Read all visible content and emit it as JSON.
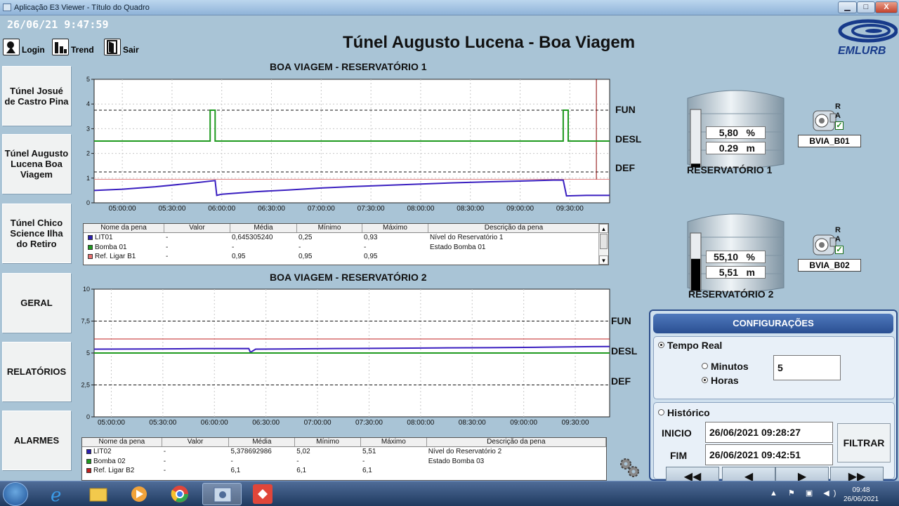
{
  "window": {
    "title": "Aplicação E3 Viewer - Título do Quadro",
    "min": "▁",
    "max": "□",
    "close": "X"
  },
  "header": {
    "clock": "26/06/21 9:47:59",
    "title": "Túnel Augusto Lucena - Boa Viagem",
    "logo_text": "EMLURB",
    "buttons": {
      "login": "Login",
      "trend": "Trend",
      "exit": "Sair"
    }
  },
  "nav": [
    {
      "label": "Túnel Josué de Castro Pina"
    },
    {
      "label": "Túnel Augusto Lucena Boa Viagem"
    },
    {
      "label": "Túnel Chico Science Ilha do Retiro"
    },
    {
      "label": "GERAL"
    },
    {
      "label": "RELATÓRIOS"
    },
    {
      "label": "ALARMES"
    }
  ],
  "legend_headers": [
    "Nome da pena",
    "Valor",
    "Média",
    "Mínimo",
    "Máximo",
    "Descrição da pena"
  ],
  "legend1": [
    {
      "name": "LIT01",
      "valor": "-",
      "media": "0,645305240",
      "min": "0,25",
      "max": "0,93",
      "desc": "Nível do Reservatório 1",
      "color": "#2b1fb0"
    },
    {
      "name": "Bomba 01",
      "valor": "-",
      "media": "-",
      "min": "-",
      "max": "-",
      "desc": "Estado Bomba 01",
      "color": "#1f9a1f"
    },
    {
      "name": "Ref. Ligar B1",
      "valor": "-",
      "media": "0,95",
      "min": "0,95",
      "max": "0,95",
      "desc": "",
      "color": "#e87070"
    }
  ],
  "legend2": [
    {
      "name": "LIT02",
      "valor": "-",
      "media": "5,378692986",
      "min": "5,02",
      "max": "5,51",
      "desc": "Nível do Reservatório 2",
      "color": "#2b1fb0"
    },
    {
      "name": "Bomba 02",
      "valor": "-",
      "media": "-",
      "min": "-",
      "max": "-",
      "desc": "Estado Bomba 03",
      "color": "#1f9a1f"
    },
    {
      "name": "Ref. Ligar B2",
      "valor": "-",
      "media": "6,1",
      "min": "6,1",
      "max": "6,1",
      "desc": "",
      "color": "#c02020"
    }
  ],
  "side_labels1": {
    "fun": "FUN",
    "desl": "DESL",
    "def": "DEF"
  },
  "side_labels2": {
    "fun": "FUN",
    "desl": "DESL",
    "def": "DEF"
  },
  "tanks": [
    {
      "percent": "5,80",
      "percent_unit": "%",
      "meters": "0.29",
      "meters_unit": "m",
      "name": "RESERVATÓRIO 1",
      "fill": 0.058
    },
    {
      "percent": "55,10",
      "percent_unit": "%",
      "meters": "5,51",
      "meters_unit": "m",
      "name": "RESERVATÓRIO 2",
      "fill": 0.551
    }
  ],
  "pumps": [
    {
      "name": "BVIA_B01",
      "r": "R",
      "a": "A"
    },
    {
      "name": "BVIA_B02",
      "r": "R",
      "a": "A"
    }
  ],
  "config": {
    "header": "CONFIGURAÇÕES",
    "realtime": "Tempo Real",
    "minutos": "Minutos",
    "horas": "Horas",
    "period_value": "5",
    "historico": "Histórico",
    "inicio_label": "INICIO",
    "inicio_value": "26/06/2021 09:28:27",
    "fim_label": "FIM",
    "fim_value": "26/06/2021 09:42:51",
    "filtrar": "FILTRAR",
    "nav_buttons": [
      "◀◀",
      "◀",
      "▶",
      "▶▶"
    ]
  },
  "taskbar": {
    "time": "09:48",
    "date": "26/06/2021"
  },
  "chart_data": [
    {
      "type": "line",
      "title": "BOA VIAGEM - RESERVATÓRIO 1",
      "xlabel": "",
      "ylabel": "",
      "x_ticks": [
        "05:00:00",
        "05:30:00",
        "06:00:00",
        "06:30:00",
        "07:00:00",
        "07:30:00",
        "08:00:00",
        "08:30:00",
        "09:00:00",
        "09:30:00"
      ],
      "x_tick_values": [
        300,
        330,
        360,
        390,
        420,
        450,
        480,
        510,
        540,
        570
      ],
      "xlim": [
        283,
        594
      ],
      "y_ticks": [
        "0",
        "1",
        "2",
        "3",
        "4",
        "5"
      ],
      "y_tick_values": [
        0,
        1,
        2,
        3,
        4,
        5
      ],
      "ylim": [
        0,
        5
      ],
      "grid": true,
      "hlines": [
        {
          "y": 3.75,
          "style": "dashed",
          "color": "#111"
        },
        {
          "y": 1.25,
          "style": "dashed",
          "color": "#111"
        },
        {
          "y": 0.95,
          "style": "solid",
          "color": "#e08080"
        }
      ],
      "vline": {
        "x": 586,
        "color": "#8b0000"
      },
      "series": [
        {
          "name": "LIT01",
          "color": "#3a1fc0",
          "x": [
            283,
            300,
            320,
            340,
            356,
            357,
            360,
            380,
            400,
            420,
            440,
            460,
            480,
            500,
            520,
            540,
            560,
            566,
            568,
            580,
            594
          ],
          "y": [
            0.5,
            0.55,
            0.65,
            0.78,
            0.9,
            0.3,
            0.35,
            0.45,
            0.52,
            0.6,
            0.66,
            0.71,
            0.76,
            0.81,
            0.85,
            0.88,
            0.92,
            0.92,
            0.28,
            0.3,
            0.3
          ]
        },
        {
          "name": "Bomba 01",
          "color": "#1f9a1f",
          "x": [
            283,
            353,
            353,
            356,
            356,
            566,
            566,
            569,
            569,
            594
          ],
          "y": [
            2.5,
            2.5,
            3.75,
            3.75,
            2.5,
            2.5,
            3.75,
            3.75,
            2.5,
            2.5
          ]
        }
      ]
    },
    {
      "type": "line",
      "title": "BOA VIAGEM - RESERVATÓRIO 2",
      "xlabel": "",
      "ylabel": "",
      "x_ticks": [
        "05:00:00",
        "05:30:00",
        "06:00:00",
        "06:30:00",
        "07:00:00",
        "07:30:00",
        "08:00:00",
        "08:30:00",
        "09:00:00",
        "09:30:00"
      ],
      "x_tick_values": [
        300,
        330,
        360,
        390,
        420,
        450,
        480,
        510,
        540,
        570
      ],
      "xlim": [
        290,
        590
      ],
      "y_ticks": [
        "0",
        "2,5",
        "5",
        "7,5",
        "10"
      ],
      "y_tick_values": [
        0,
        2.5,
        5,
        7.5,
        10
      ],
      "ylim": [
        0,
        10
      ],
      "grid": true,
      "hlines": [
        {
          "y": 7.5,
          "style": "dashed",
          "color": "#111"
        },
        {
          "y": 2.5,
          "style": "dashed",
          "color": "#111"
        },
        {
          "y": 6.1,
          "style": "solid",
          "color": "#c02020"
        }
      ],
      "series": [
        {
          "name": "LIT02",
          "color": "#3a1fc0",
          "x": [
            290,
            320,
            350,
            380,
            381,
            384,
            400,
            430,
            460,
            490,
            520,
            550,
            580,
            590
          ],
          "y": [
            5.3,
            5.32,
            5.34,
            5.35,
            5.05,
            5.3,
            5.32,
            5.35,
            5.37,
            5.4,
            5.42,
            5.45,
            5.5,
            5.51
          ]
        },
        {
          "name": "Bomba 02",
          "color": "#1f9a1f",
          "x": [
            290,
            590
          ],
          "y": [
            5.0,
            5.0
          ]
        }
      ]
    }
  ]
}
